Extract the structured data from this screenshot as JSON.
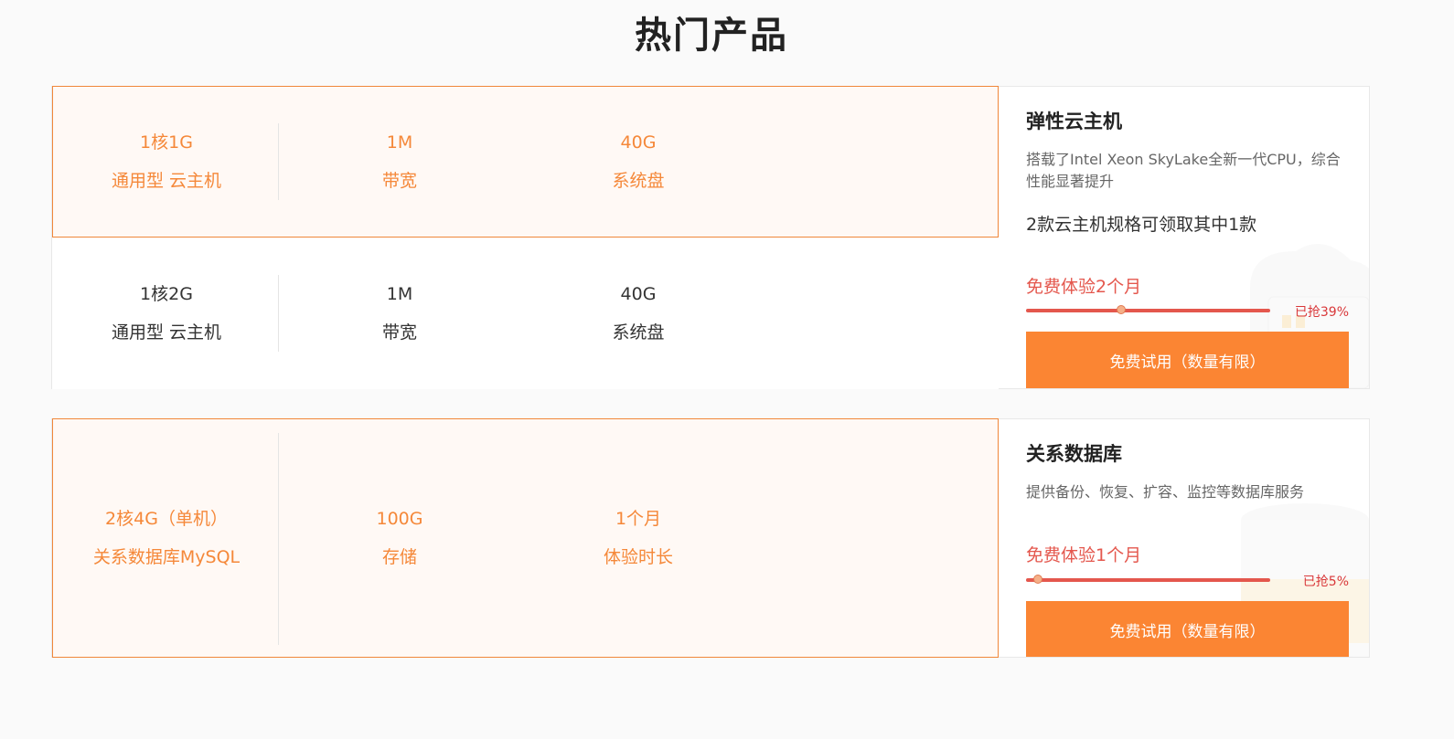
{
  "title": "热门产品",
  "products": [
    {
      "options": [
        {
          "spec1_value": "1核1G",
          "spec1_label": "通用型 云主机",
          "spec2_value": "1M",
          "spec2_label": "带宽",
          "spec3_value": "40G",
          "spec3_label": "系统盘",
          "selected": true
        },
        {
          "spec1_value": "1核2G",
          "spec1_label": "通用型 云主机",
          "spec2_value": "1M",
          "spec2_label": "带宽",
          "spec3_value": "40G",
          "spec3_label": "系统盘",
          "selected": false
        }
      ],
      "name": "弹性云主机",
      "desc": "搭载了Intel Xeon SkyLake全新一代CPU，综合性能显著提升",
      "note": "2款云主机规格可领取其中1款",
      "free": "免费体验2个月",
      "progress": 0.39,
      "claimed": "已抢39%",
      "button": "免费试用（数量有限）"
    },
    {
      "options": [
        {
          "spec1_value": "2核4G（单机）",
          "spec1_label": "关系数据库MySQL",
          "spec2_value": "100G",
          "spec2_label": "存储",
          "spec3_value": "1个月",
          "spec3_label": "体验时长",
          "selected": true
        }
      ],
      "name": "关系数据库",
      "desc": "提供备份、恢复、扩容、监控等数据库服务",
      "free": "免费体验1个月",
      "progress": 0.05,
      "claimed": "已抢5%",
      "button": "免费试用（数量有限）"
    }
  ],
  "colors": {
    "accent": "#fb8533",
    "active_text": "#f58839",
    "active_bg": "#fff9f5",
    "progress": "#e4574d",
    "claimed": "#d9383a"
  },
  "icons": [
    "server-illustration-icon",
    "database-illustration-icon"
  ]
}
